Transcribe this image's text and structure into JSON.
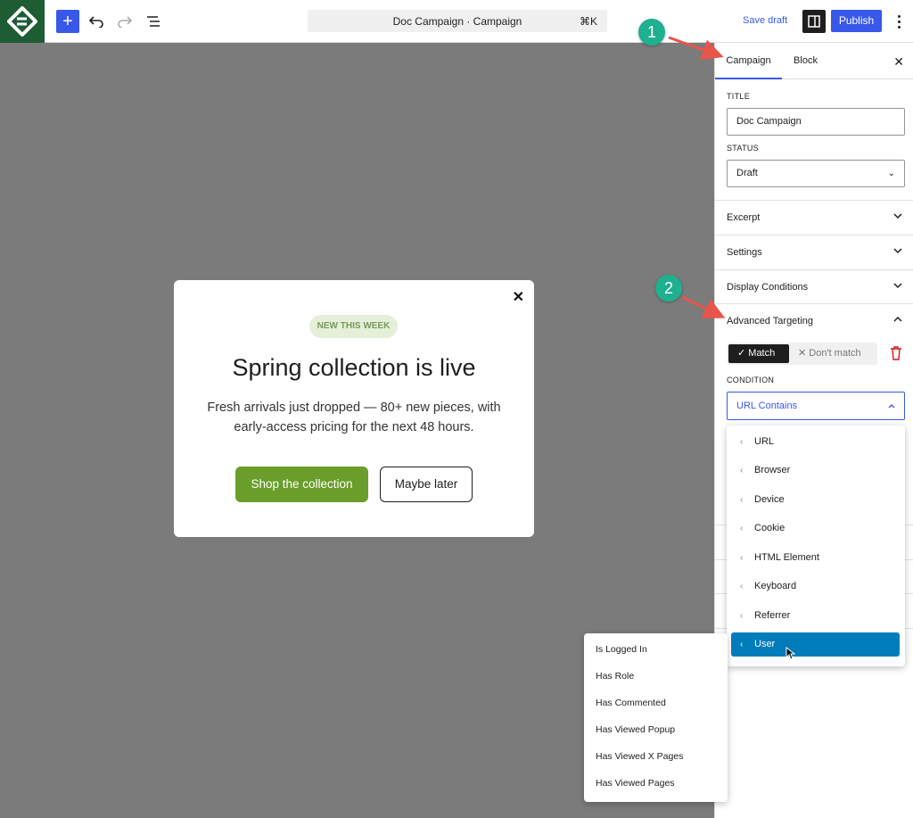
{
  "topbar": {
    "logo_icon": "editor-logo-icon",
    "add_icon": "+",
    "command_title": "Doc Campaign · Campaign",
    "command_shortcut": "⌘K",
    "save_draft": "Save draft",
    "publish": "Publish"
  },
  "popup": {
    "close": "✕",
    "badge": "NEW THIS WEEK",
    "headline": "Spring collection is live",
    "body": "Fresh arrivals just dropped — 80+ new pieces, with early-access pricing for the next 48 hours.",
    "primary_cta": "Shop the collection",
    "secondary_cta": "Maybe later",
    "accent_color": "#6a9d29"
  },
  "sidebar": {
    "tabs": [
      "Campaign",
      "Block"
    ],
    "close": "✕",
    "title_label": "TITLE",
    "title_value": "Doc Campaign",
    "status_label": "STATUS",
    "status_value": "Draft",
    "sections": {
      "excerpt": "Excerpt",
      "settings": "Settings",
      "display_conditions": "Display Conditions",
      "advanced_targeting": "Advanced Targeting"
    },
    "match": "Match",
    "dont_match": "Don't match",
    "condition_label": "CONDITION",
    "condition_value": "URL Contains"
  },
  "dropdown": {
    "items": [
      "URL",
      "Browser",
      "Device",
      "Cookie",
      "HTML Element",
      "Keyboard",
      "Referrer",
      "User"
    ],
    "active": "User"
  },
  "submenu": {
    "items": [
      "Is Logged In",
      "Has Role",
      "Has Commented",
      "Has Viewed Popup",
      "Has Viewed X Pages",
      "Has Viewed Pages"
    ]
  },
  "annotations": {
    "callout_1": "1",
    "callout_2": "2"
  },
  "colors": {
    "brand_blue": "#3858e9",
    "active_item": "#007cba",
    "callout": "#1eb090",
    "arrow": "#e8554a"
  }
}
